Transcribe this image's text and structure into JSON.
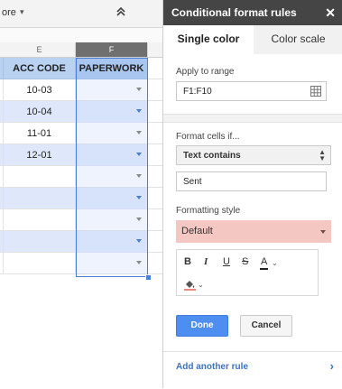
{
  "toolbar": {
    "more_label": "ore",
    "more_caret": "▾"
  },
  "sheet": {
    "columns": [
      {
        "letter": "E",
        "selected": false
      },
      {
        "letter": "F",
        "selected": true
      }
    ],
    "header_row": {
      "e": "ACC CODE",
      "f": "PAPERWORK"
    },
    "rows": [
      {
        "e": "10-03",
        "tinted": false
      },
      {
        "e": "10-04",
        "tinted": true
      },
      {
        "e": "11-01",
        "tinted": false
      },
      {
        "e": "12-01",
        "tinted": true
      },
      {
        "e": "",
        "tinted": false
      },
      {
        "e": "",
        "tinted": true
      },
      {
        "e": "",
        "tinted": false
      },
      {
        "e": "",
        "tinted": true
      },
      {
        "e": "",
        "tinted": false
      }
    ]
  },
  "panel": {
    "title": "Conditional format rules",
    "tabs": {
      "single_color": "Single color",
      "color_scale": "Color scale"
    },
    "apply_range_label": "Apply to range",
    "range_value": "F1:F10",
    "format_if_label": "Format cells if...",
    "condition": "Text contains",
    "condition_value": "Sent",
    "formatting_style_label": "Formatting style",
    "style_value": "Default",
    "style_color": "#f4c7c3",
    "format_buttons": {
      "bold": "B",
      "italic": "I",
      "underline": "U",
      "strike": "S",
      "text_color": "A"
    },
    "done_label": "Done",
    "cancel_label": "Cancel",
    "add_rule_label": "Add another rule"
  },
  "colors": {
    "accent": "#4d8ef0",
    "header_bg": "#454545",
    "link": "#3b72c4"
  }
}
